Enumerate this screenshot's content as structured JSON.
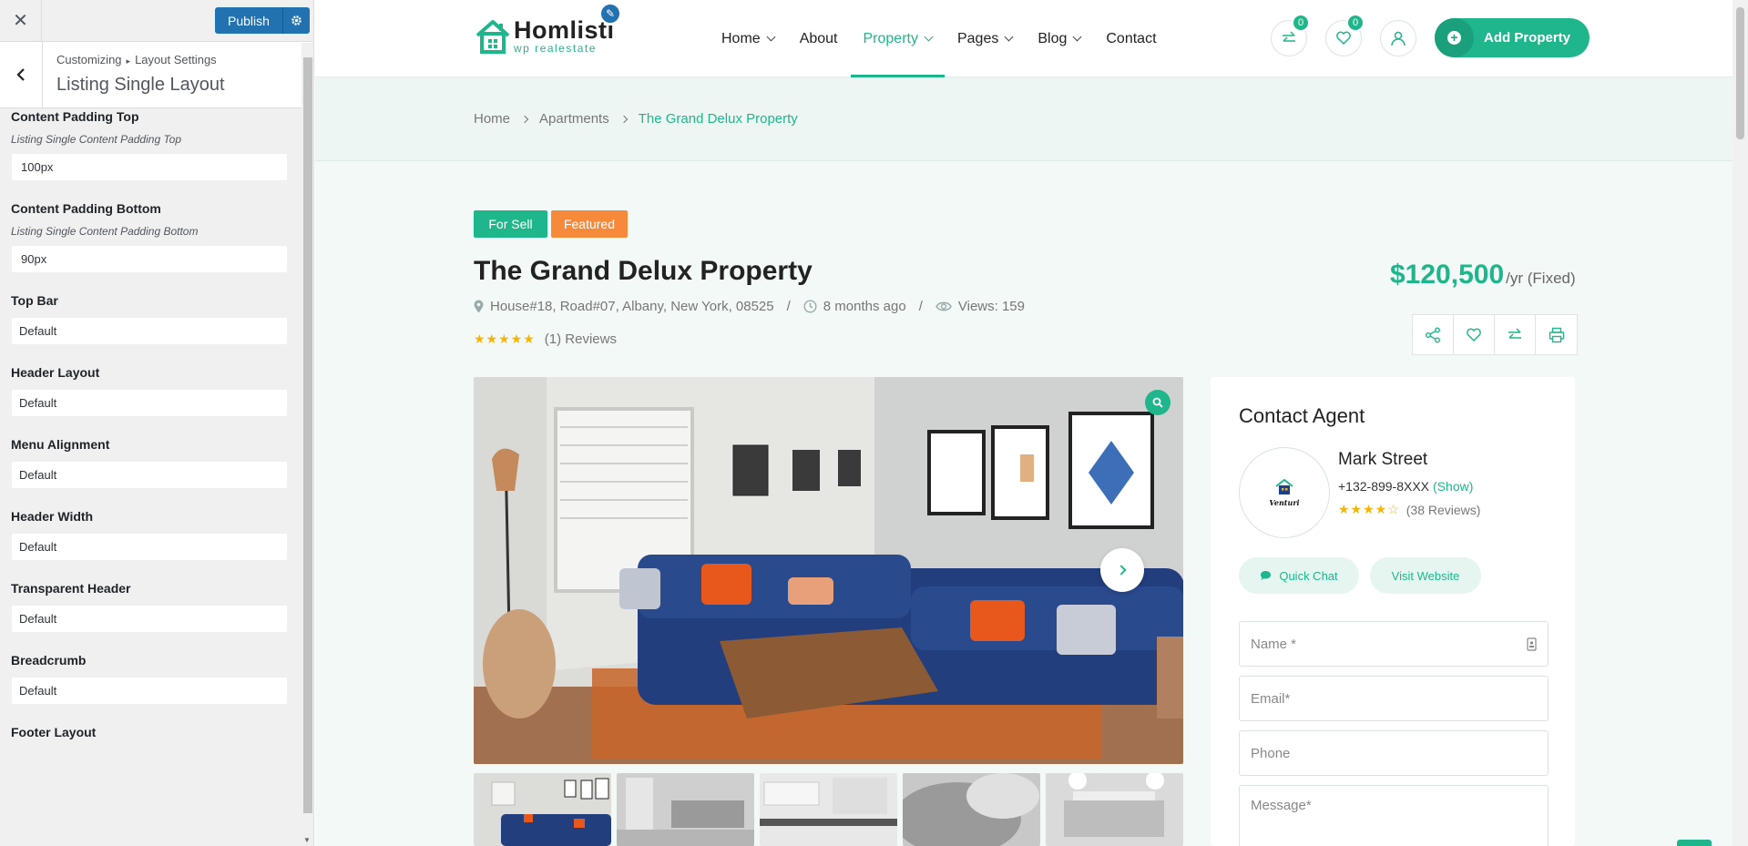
{
  "customizer": {
    "publish_label": "Publish",
    "breadcrumb": [
      "Customizing",
      "Layout Settings"
    ],
    "section_title": "Listing Single Layout",
    "controls": [
      {
        "label": "Content Padding Top",
        "desc": "Listing Single Content Padding Top",
        "value": "100px"
      },
      {
        "label": "Content Padding Bottom",
        "desc": "Listing Single Content Padding Bottom",
        "value": "90px"
      },
      {
        "label": "Top Bar",
        "value": "Default"
      },
      {
        "label": "Header Layout",
        "value": "Default"
      },
      {
        "label": "Menu Alignment",
        "value": "Default"
      },
      {
        "label": "Header Width",
        "value": "Default"
      },
      {
        "label": "Transparent Header",
        "value": "Default"
      },
      {
        "label": "Breadcrumb",
        "value": "Default"
      },
      {
        "label": "Footer Layout"
      }
    ]
  },
  "header": {
    "logo_name": "Homlisti",
    "logo_sub": "wp realestate",
    "nav": [
      "Home",
      "About",
      "Property",
      "Pages",
      "Blog",
      "Contact"
    ],
    "compare_count": "0",
    "wishlist_count": "0",
    "add_property_label": "Add Property"
  },
  "breadcrumb": {
    "home": "Home",
    "category": "Apartments",
    "current": "The Grand Delux Property"
  },
  "listing": {
    "tag_sell": "For Sell",
    "tag_featured": "Featured",
    "title": "The Grand Delux Property",
    "address": "House#18, Road#07, Albany, New York, 08525",
    "time": "8 months ago",
    "views": "Views: 159",
    "rating_stars": "★★★★★",
    "reviews": "(1) Reviews",
    "price": "$120,500",
    "price_period": "/yr (Fixed)"
  },
  "agent": {
    "heading": "Contact Agent",
    "logo_text": "Venturi",
    "name": "Mark Street",
    "phone": "+132-899-8XXX",
    "show_label": "(Show)",
    "rating_stars": "★★★★☆",
    "reviews": "(38 Reviews)",
    "chat_label": "Quick Chat",
    "website_label": "Visit Website",
    "name_placeholder": "Name *",
    "email_placeholder": "Email*",
    "phone_placeholder": "Phone",
    "message_placeholder": "Message*"
  },
  "colors": {
    "brand": "#1fb68c",
    "featured": "#f6893a",
    "wp_blue": "#2271b1"
  }
}
